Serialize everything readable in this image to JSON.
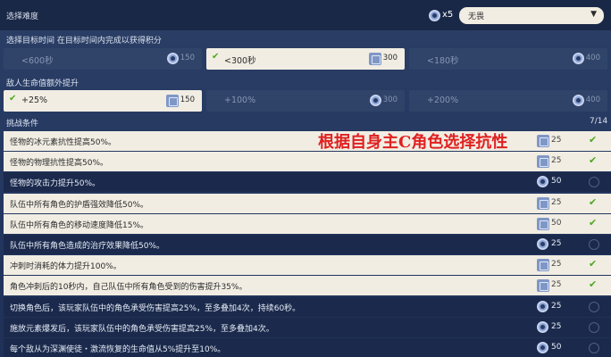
{
  "difficulty": {
    "label": "选择难度",
    "multiplier": "x5",
    "selected": "无畏",
    "icon": "gear-icon"
  },
  "time": {
    "label": "选择目标时间 在目标时间内完成以获得积分",
    "options": [
      {
        "label": "<600秒",
        "value": "150",
        "selected": false
      },
      {
        "label": "<300秒",
        "value": "300",
        "selected": true
      },
      {
        "label": "<180秒",
        "value": "400",
        "selected": false
      }
    ]
  },
  "enemy": {
    "label": "敌人生命值额外提升",
    "options": [
      {
        "label": "+25%",
        "value": "150",
        "selected": true
      },
      {
        "label": "+100%",
        "value": "300",
        "selected": false
      },
      {
        "label": "+200%",
        "value": "400",
        "selected": false
      }
    ]
  },
  "challenges": {
    "label": "挑战条件",
    "count": "7/14",
    "items": [
      {
        "text": "怪物的冰元素抗性提高50%。",
        "points": "25",
        "selected": true
      },
      {
        "text": "怪物的物理抗性提高50%。",
        "points": "25",
        "selected": true
      },
      {
        "text": "怪物的攻击力提升50%。",
        "points": "50",
        "selected": false
      },
      {
        "text": "队伍中所有角色的护盾强效降低50%。",
        "points": "25",
        "selected": true
      },
      {
        "text": "队伍中所有角色的移动速度降低15%。",
        "points": "50",
        "selected": true
      },
      {
        "text": "队伍中所有角色造成的治疗效果降低50%。",
        "points": "25",
        "selected": false
      },
      {
        "text": "冲刺时消耗的体力提升100%。",
        "points": "25",
        "selected": true
      },
      {
        "text": "角色冲刺后的10秒内，自己队伍中所有角色受到的伤害提升35%。",
        "points": "25",
        "selected": true
      },
      {
        "text": "切换角色后，该玩家队伍中的角色承受伤害提高25%，至多叠加4次，持续60秒。",
        "points": "25",
        "selected": false
      },
      {
        "text": "施放元素爆发后，该玩家队伍中的角色承受伤害提高25%，至多叠加4次。",
        "points": "25",
        "selected": false
      },
      {
        "text": "每个敌从为深渊使徒・激流恢复的生命值从5%提升至10%。",
        "points": "50",
        "selected": false
      }
    ]
  },
  "annotation": "根据自身主C角色选择抗性",
  "colors": {
    "accent_check": "#4fa81e",
    "annotation": "#e02020",
    "selected_bg": "#f1ede3"
  }
}
